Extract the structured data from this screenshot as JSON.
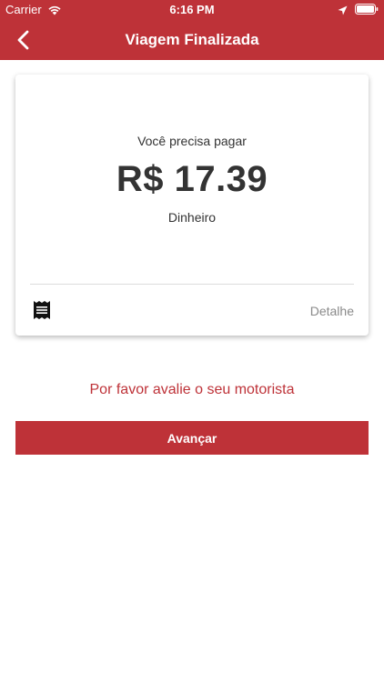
{
  "status_bar": {
    "carrier": "Carrier",
    "time": "6:16 PM",
    "icons": [
      "wifi-icon",
      "location-icon",
      "battery-icon"
    ]
  },
  "nav": {
    "title": "Viagem Finalizada",
    "back_icon": "chevron-left-icon"
  },
  "card": {
    "pay_label": "Você precisa pagar",
    "amount": "R$ 17.39",
    "payment_method": "Dinheiro",
    "receipt_icon": "receipt-icon",
    "detail_label": "Detalhe"
  },
  "rate_prompt": "Por favor avalie o seu motorista",
  "advance_button": "Avançar",
  "colors": {
    "accent": "#BE3238",
    "text_dark": "#333333",
    "text_muted": "#8a8a8a"
  }
}
